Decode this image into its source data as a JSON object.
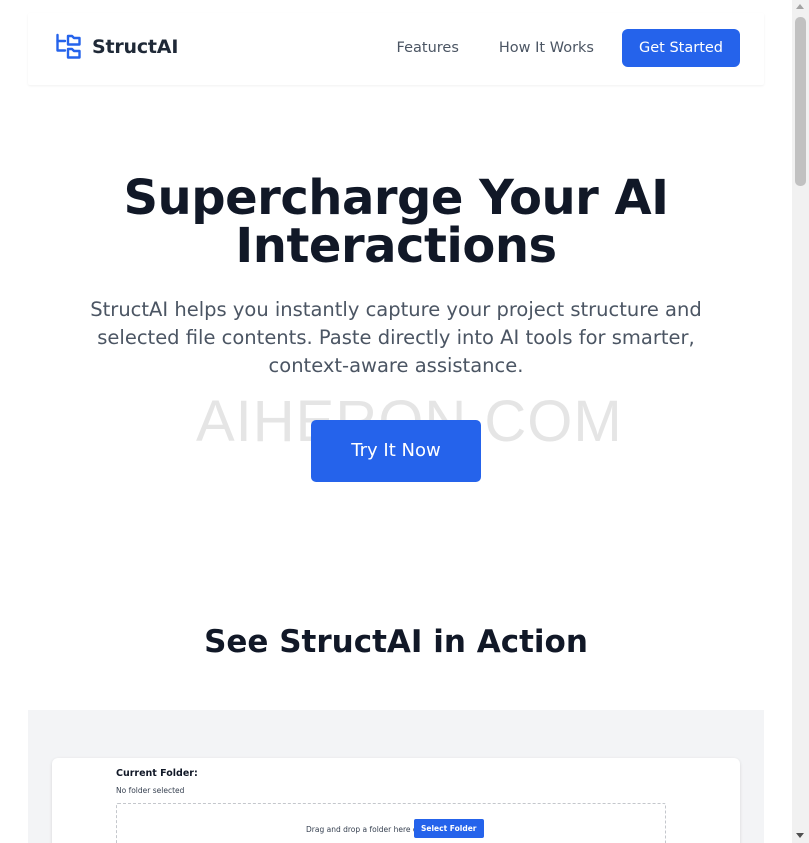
{
  "brand": {
    "name": "StructAI",
    "icon": "folder-tree-icon",
    "accent_color": "#2563eb"
  },
  "nav": {
    "features_label": "Features",
    "how_it_works_label": "How It Works",
    "get_started_label": "Get Started"
  },
  "hero": {
    "title": "Supercharge Your AI Interactions",
    "subtitle": "StructAI helps you instantly capture your project structure and selected file contents. Paste directly into AI tools for smarter, context-aware assistance.",
    "cta_label": "Try It Now",
    "watermark": "AIHERON.COM"
  },
  "demo": {
    "section_title": "See StructAI in Action",
    "current_folder_label": "Current Folder:",
    "current_folder_value": "No folder selected",
    "drop_text": "Drag and drop a folder here or",
    "select_button_label": "Select Folder"
  },
  "scrollbar": {
    "up_icon": "scroll-up-arrow-icon",
    "down_icon": "scroll-down-arrow-icon"
  }
}
